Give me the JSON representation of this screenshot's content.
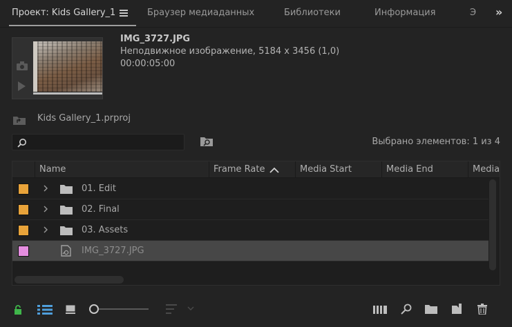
{
  "tabs": [
    {
      "label": "Проект: Kids Gallery_1",
      "active": true
    },
    {
      "label": "Браузер медиаданных",
      "active": false
    },
    {
      "label": "Библиотеки",
      "active": false
    },
    {
      "label": "Информация",
      "active": false
    },
    {
      "label": "Э",
      "active": false
    }
  ],
  "overflow_glyph": "»",
  "preview": {
    "name": "IMG_3727.JPG",
    "type": "Неподвижное изображение, 5184 x 3456 (1,0)",
    "duration": "00:00:05:00"
  },
  "project_path": "Kids Gallery_1.prproj",
  "search": {
    "value": "",
    "placeholder": ""
  },
  "selection_count": "Выбрано элементов: 1 из 4",
  "columns": [
    "Name",
    "Frame Rate",
    "Media Start",
    "Media End",
    "Media"
  ],
  "rows": [
    {
      "label": "01. Edit",
      "kind": "folder",
      "color": "#e8a33a"
    },
    {
      "label": "02. Final",
      "kind": "folder",
      "color": "#e8a33a"
    },
    {
      "label": "03. Assets",
      "kind": "folder",
      "color": "#e8a33a"
    },
    {
      "label": "IMG_3727.JPG",
      "kind": "still",
      "color": "#e58ee0",
      "selected": true
    }
  ],
  "colors": {
    "background": "#232323",
    "selected_row": "#474747",
    "accent_blue": "#4f9fdc",
    "lock_green": "#3fb64a"
  },
  "icons": [
    "lock-icon",
    "list-view-icon",
    "icon-view-icon",
    "zoom-slider",
    "sort-icon",
    "automate-icon",
    "find-icon",
    "new-bin-icon",
    "new-item-icon",
    "trash-icon"
  ]
}
